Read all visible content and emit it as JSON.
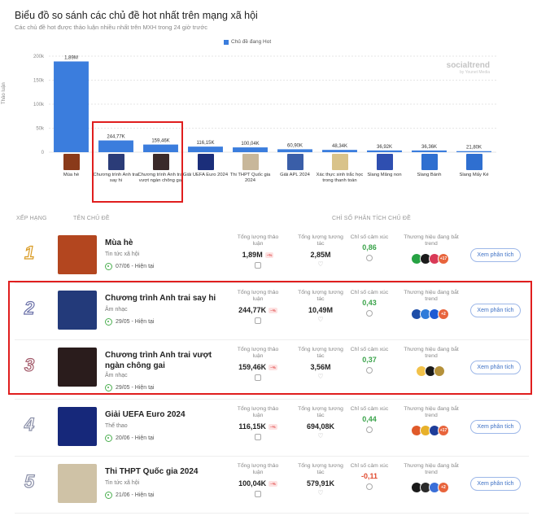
{
  "header": {
    "title": "Biểu đồ so sánh các chủ đề hot nhất trên mạng xã hội",
    "subtitle": "Các chủ đề hot được thảo luận nhiều nhất trên MXH trong 24 giờ trước"
  },
  "watermark": {
    "main": "socialtrend",
    "sub": "by Younet Media"
  },
  "chart_data": {
    "type": "bar",
    "legend": "Chủ đề đang Hot",
    "ylabel": "Thảo luận",
    "yticks": [
      "0",
      "50k",
      "100k",
      "150k",
      "200k"
    ],
    "ytick_values": [
      0,
      500000,
      1000000,
      1500000,
      2000000
    ],
    "ylim": [
      0,
      2000000
    ],
    "categories": [
      "Mùa hè",
      "Chương trình Anh trai say hi",
      "Chương trình Anh trai vượt ngàn chông gai",
      "Giải UEFA Euro 2024",
      "Thi THPT Quốc gia 2024",
      "Giải APL 2024",
      "Xác thực sinh trắc học trong thanh toán",
      "Slang Mãng non",
      "Slang Bánh",
      "Slang Mấy Ké"
    ],
    "values": [
      1890000,
      244770,
      159460,
      116150,
      100040,
      60900,
      48340,
      36920,
      36360,
      21800
    ],
    "data_labels": [
      "1,89M",
      "244,77K",
      "159,46K",
      "116,15K",
      "100,04K",
      "60,90K",
      "48,34K",
      "36,92K",
      "36,36K",
      "21,80K"
    ],
    "ytick_display": [
      "0",
      "50k",
      "100k",
      "150k",
      "200k"
    ],
    "grid": true,
    "colors": {
      "bar": "#3b7ddd",
      "grid": "#e6e6e6"
    }
  },
  "table": {
    "headers": {
      "rank": "XẾP HẠNG",
      "topic": "TÊN CHỦ ĐỀ",
      "metrics": "CHỈ SỐ PHÂN TÍCH CHỦ ĐỀ"
    },
    "metric_labels": {
      "discussion": "Tổng lượng thảo luận",
      "interaction": "Tổng lượng tương tác",
      "sentiment": "Chỉ số cảm xúc",
      "brands": "Thương hiệu đang bắt trend"
    },
    "button_label": "Xem phân tích",
    "trend_badge": "~%",
    "rows": [
      {
        "rank": "1",
        "title": "Mùa hè",
        "category": "Tin tức xã hội",
        "date": "07/06 - Hiện tại",
        "discussion": "1,89M",
        "interaction": "2,85M",
        "sentiment": "0,86",
        "sentiment_sign": "pos",
        "brand_more": "+17"
      },
      {
        "rank": "2",
        "title": "Chương trình Anh trai say hi",
        "category": "Âm nhạc",
        "date": "29/05 - Hiện tại",
        "discussion": "244,77K",
        "interaction": "10,49M",
        "sentiment": "0,43",
        "sentiment_sign": "pos",
        "brand_more": "+2"
      },
      {
        "rank": "3",
        "title": "Chương trình Anh trai vượt ngàn chông gai",
        "category": "Âm nhạc",
        "date": "29/05 - Hiện tại",
        "discussion": "159,46K",
        "interaction": "3,56M",
        "sentiment": "0,37",
        "sentiment_sign": "pos",
        "brand_more": ""
      },
      {
        "rank": "4",
        "title": "Giải UEFA Euro 2024",
        "category": "Thể thao",
        "date": "20/06 - Hiện tại",
        "discussion": "116,15K",
        "interaction": "694,08K",
        "sentiment": "0,44",
        "sentiment_sign": "pos",
        "brand_more": "+17"
      },
      {
        "rank": "5",
        "title": "Thi THPT Quốc gia 2024",
        "category": "Tin tức xã hội",
        "date": "21/06 - Hiện tại",
        "discussion": "100,04K",
        "interaction": "579,91K",
        "sentiment": "-0,11",
        "sentiment_sign": "neg",
        "brand_more": "+2"
      }
    ]
  },
  "highlight_color": "#e01e1e"
}
